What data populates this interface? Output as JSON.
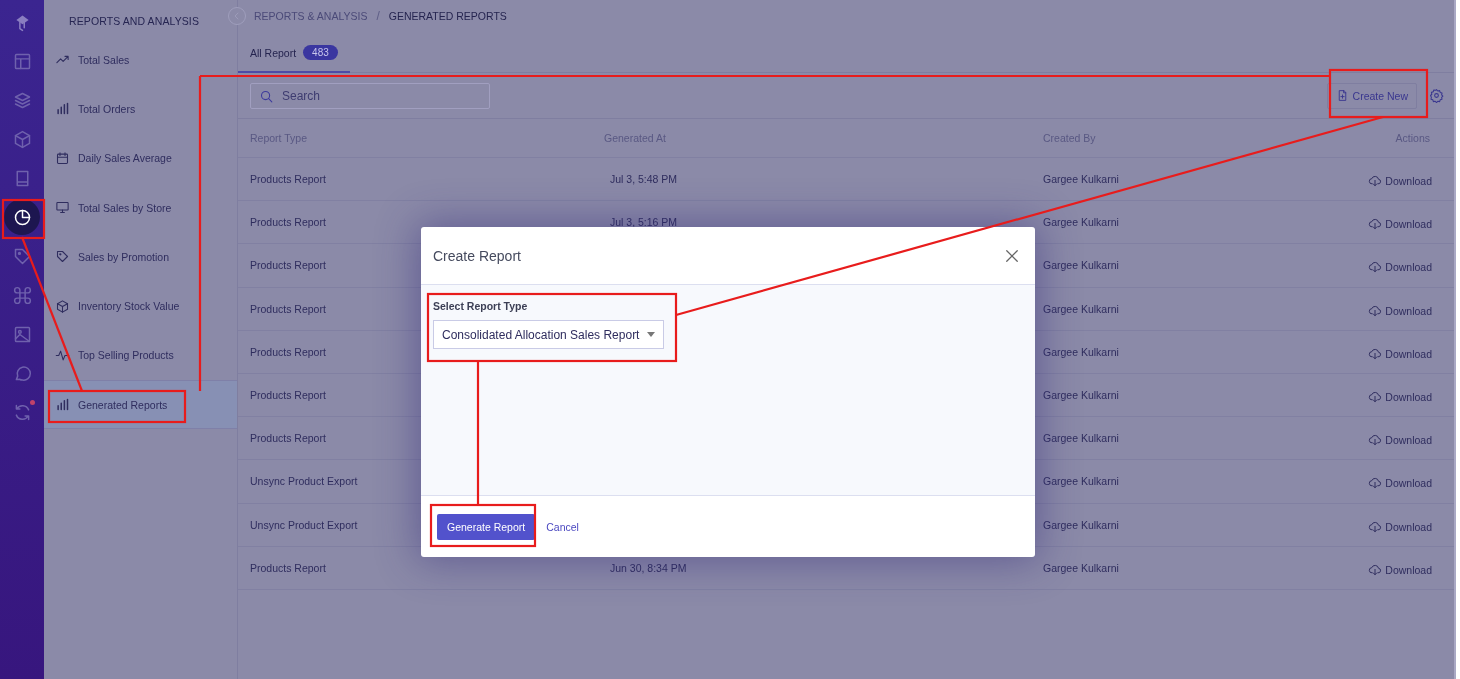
{
  "rail": {
    "items": [
      {
        "selected": false
      },
      {
        "selected": false
      },
      {
        "selected": false
      },
      {
        "selected": false
      },
      {
        "selected": false
      },
      {
        "selected": true
      },
      {
        "selected": false
      },
      {
        "selected": false
      },
      {
        "selected": false
      },
      {
        "selected": false
      },
      {
        "selected": false
      }
    ]
  },
  "sidebar": {
    "title": "REPORTS AND ANALYSIS",
    "items": [
      {
        "label": "Total Sales",
        "selected": false
      },
      {
        "label": "Total Orders",
        "selected": false
      },
      {
        "label": "Daily Sales Average",
        "selected": false
      },
      {
        "label": "Total Sales by Store",
        "selected": false
      },
      {
        "label": "Sales by Promotion",
        "selected": false
      },
      {
        "label": "Inventory Stock Value",
        "selected": false
      },
      {
        "label": "Top Selling Products",
        "selected": false
      },
      {
        "label": "Generated Reports",
        "selected": true
      }
    ]
  },
  "breadcrumb": {
    "items": [
      "REPORTS & ANALYSIS",
      "GENERATED REPORTS"
    ],
    "separator": "/"
  },
  "tabs": [
    {
      "label": "All Report",
      "count": "483",
      "selected": true
    }
  ],
  "search": {
    "placeholder": "Search"
  },
  "create_button": "Create New",
  "table": {
    "columns": [
      "Report Type",
      "Generated At",
      "Created By",
      "Actions"
    ],
    "rows": [
      {
        "report_type": "Products Report",
        "generated_at": "Jul 3, 5:48 PM",
        "created_by": "Gargee Kulkarni",
        "action": "Download"
      },
      {
        "report_type": "Products Report",
        "generated_at": "Jul 3, 5:16 PM",
        "created_by": "Gargee Kulkarni",
        "action": "Download"
      },
      {
        "report_type": "Products Report",
        "created_by": "Gargee Kulkarni",
        "action": "Download"
      },
      {
        "report_type": "Products Report",
        "created_by": "Gargee Kulkarni",
        "action": "Download"
      },
      {
        "report_type": "Products Report",
        "created_by": "Gargee Kulkarni",
        "action": "Download"
      },
      {
        "report_type": "Products Report",
        "created_by": "Gargee Kulkarni",
        "action": "Download"
      },
      {
        "report_type": "Products Report",
        "created_by": "Gargee Kulkarni",
        "action": "Download"
      },
      {
        "report_type": "Unsync Product Export",
        "created_by": "Gargee Kulkarni",
        "action": "Download"
      },
      {
        "report_type": "Unsync Product Export",
        "created_by": "Gargee Kulkarni",
        "action": "Download"
      },
      {
        "report_type": "Products Report",
        "generated_at": "Jun 30, 8:34 PM",
        "created_by": "Gargee Kulkarni",
        "action": "Download"
      }
    ]
  },
  "modal": {
    "title": "Create Report",
    "field_label": "Select Report Type",
    "field_value": "Consolidated Allocation Sales Report",
    "primary_button": "Generate Report",
    "cancel_link": "Cancel"
  }
}
